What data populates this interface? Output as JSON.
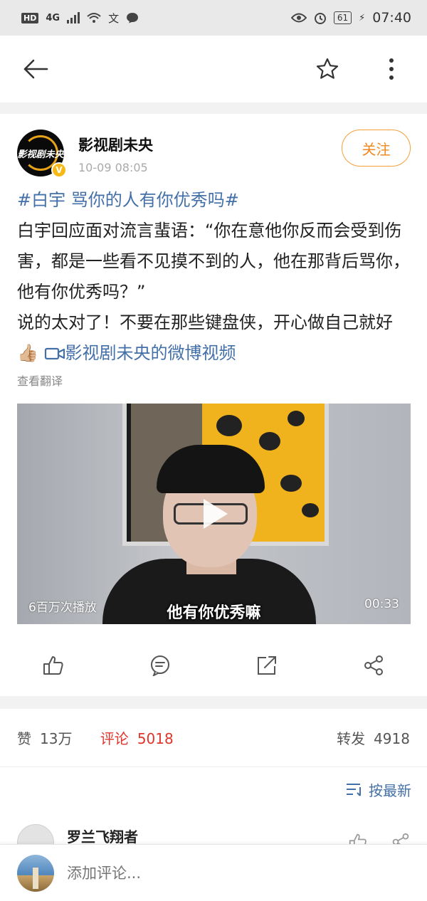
{
  "status_bar": {
    "hd": "HD",
    "network": "4G",
    "time": "07:40",
    "battery": "61",
    "icons": [
      "signal-icon",
      "wifi-icon",
      "translate-icon",
      "chat-bubble-icon",
      "eye-icon",
      "alarm-icon",
      "battery-icon"
    ]
  },
  "nav": {
    "back_icon": "back-arrow-icon",
    "favorite_icon": "star-icon",
    "more_icon": "more-vertical-icon"
  },
  "post": {
    "author": "影视剧未央",
    "avatar_text": "影视剧未央",
    "verified_badge": "V",
    "time": "10-09 08:05",
    "follow_label": "关注",
    "topic": "#白宇 骂你的人有你优秀吗#",
    "body_line1": "白宇回应面对流言蜚语：“你在意他你反而会受到伤害，都是一些看不见摸不到的人，他在那背后骂你，他有你优秀吗？”",
    "body_line2": "说的太对了！不要在那些键盘侠，开心做自己就好",
    "emoji": "👍🏼",
    "video_link": "影视剧未央的微博视频",
    "translate_label": "查看翻译"
  },
  "video": {
    "play_count": "6百万次播放",
    "duration": "00:33",
    "subtitle": "他有你优秀嘛"
  },
  "actions": [
    "like-icon",
    "comment-icon",
    "repost-icon",
    "share-icon"
  ],
  "stats": {
    "likes_label": "赞",
    "likes_count": "13万",
    "comments_label": "评论",
    "comments_count": "5018",
    "reposts_label": "转发",
    "reposts_count": "4918"
  },
  "sort": {
    "label": "按最新"
  },
  "comment": {
    "author": "罗兰飞翔者"
  },
  "input": {
    "placeholder": "添加评论..."
  },
  "colors": {
    "accent_blue": "#4470a8",
    "follow_orange": "#f08a1f",
    "active_red": "#e0352b"
  }
}
